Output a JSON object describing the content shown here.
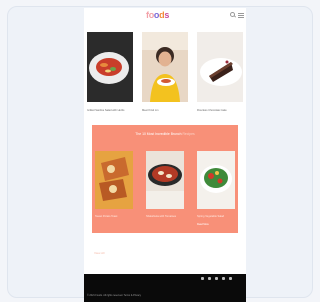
{
  "header": {
    "logo_parts": [
      "fo",
      "o",
      "d",
      "s"
    ],
    "search_icon": "search-icon",
    "menu_icon": "menu-icon"
  },
  "featured": [
    {
      "caption": "Grilled Sardine Salad with Herbs"
    },
    {
      "caption": "Meet Kristi Lin"
    },
    {
      "caption": "Flourless Chocolate Cake"
    }
  ],
  "panel": {
    "title_main": "The 10 Most Incredible Brunch",
    "title_accent": "Recipes",
    "items": [
      {
        "caption": "Sweet Potato Toast"
      },
      {
        "caption": "Shakshuka with Tomatoes"
      },
      {
        "caption": "Spring Vegetable Salad"
      }
    ],
    "more_label": "Read More"
  },
  "small_link": "View All",
  "footer": {
    "text": "© 2021 Foods. All rights reserved. Terms & Privacy"
  },
  "colors": {
    "panel": "#f89078",
    "footer": "#0a0a0a"
  }
}
